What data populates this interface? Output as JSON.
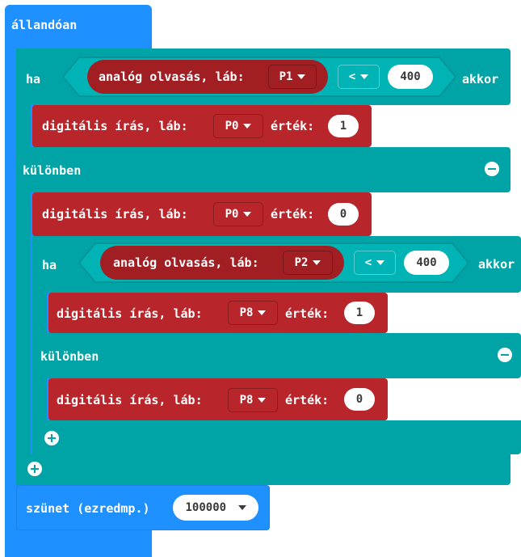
{
  "forever_label": "állandóan",
  "outer_if": {
    "if_label": "ha",
    "read_label": "analóg olvasás, láb:",
    "read_pin": "P1",
    "operator": "<",
    "compare_value": "400",
    "then_label": "akkor",
    "then_write": {
      "label": "digitális írás, láb:",
      "pin": "P0",
      "value_label": "érték:",
      "value": "1"
    },
    "else_label": "különben",
    "else_write": {
      "label": "digitális írás, láb:",
      "pin": "P0",
      "value_label": "érték:",
      "value": "0"
    }
  },
  "inner_if": {
    "if_label": "ha",
    "read_label": "analóg olvasás, láb:",
    "read_pin": "P2",
    "operator": "<",
    "compare_value": "400",
    "then_label": "akkor",
    "then_write": {
      "label": "digitális írás, láb:",
      "pin": "P8",
      "value_label": "érték:",
      "value": "1"
    },
    "else_label": "különben",
    "else_write": {
      "label": "digitális írás, láb:",
      "pin": "P8",
      "value_label": "érték:",
      "value": "0"
    }
  },
  "pause": {
    "label": "szünet (ezredmp.)",
    "value": "100000"
  },
  "colors": {
    "loops": "#1e90ff",
    "logic": "#00a4a6",
    "pins": "#b8252a"
  }
}
